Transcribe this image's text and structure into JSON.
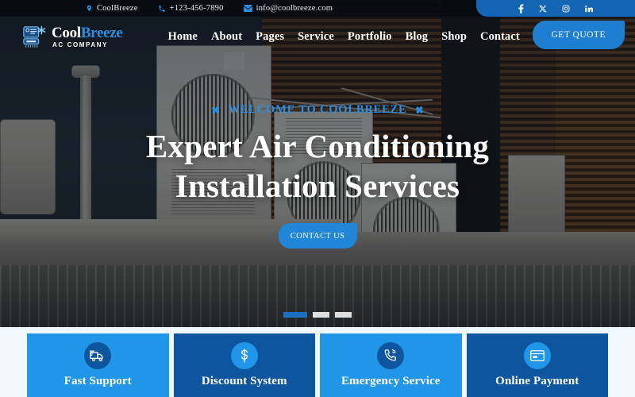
{
  "topbar": {
    "items": [
      {
        "icon": "location-pin-icon",
        "label": "CoolBreeze"
      },
      {
        "icon": "phone-icon",
        "label": "+123-456-7890"
      },
      {
        "icon": "envelope-icon",
        "label": "info@coolbreeze.com"
      }
    ],
    "social": [
      {
        "icon": "facebook-icon",
        "label": "f"
      },
      {
        "icon": "twitter-x-icon",
        "label": "X"
      },
      {
        "icon": "instagram-icon",
        "label": ""
      },
      {
        "icon": "linkedin-icon",
        "label": "in"
      }
    ],
    "social_bg": "#1565b5"
  },
  "header": {
    "logo": {
      "name_part1": "Cool",
      "name_part2": "Breeze",
      "tagline": "AC COMPANY"
    },
    "nav": [
      {
        "label": "Home"
      },
      {
        "label": "About"
      },
      {
        "label": "Pages"
      },
      {
        "label": "Service"
      },
      {
        "label": "Portfolio"
      },
      {
        "label": "Blog"
      },
      {
        "label": "Shop"
      },
      {
        "label": "Contact"
      }
    ],
    "search_icon": "search-icon",
    "quote_button": "GET QUOTE",
    "accent": "#1e7fd0"
  },
  "hero": {
    "eyebrow": "WELCOME TO COOLBREEZE",
    "eyebrow_icon": "fan-icon",
    "title_line1": "Expert Air Conditioning",
    "title_line2": "Installation Services",
    "cta": "CONTACT US",
    "accent": "#2186d8",
    "slides": [
      {
        "active": true
      },
      {
        "active": false
      },
      {
        "active": false
      }
    ]
  },
  "features": [
    {
      "title": "Fast Support",
      "icon": "delivery-truck-icon",
      "style": "light"
    },
    {
      "title": "Discount System",
      "icon": "dollar-sign-icon",
      "style": "dark"
    },
    {
      "title": "Emergency Service",
      "icon": "phone-ring-icon",
      "style": "light"
    },
    {
      "title": "Online Payment",
      "icon": "credit-card-icon",
      "style": "dark"
    }
  ],
  "colors": {
    "light_blue": "#2196e8",
    "dark_blue": "#0d569f",
    "page_bg": "#f0f7fd"
  }
}
